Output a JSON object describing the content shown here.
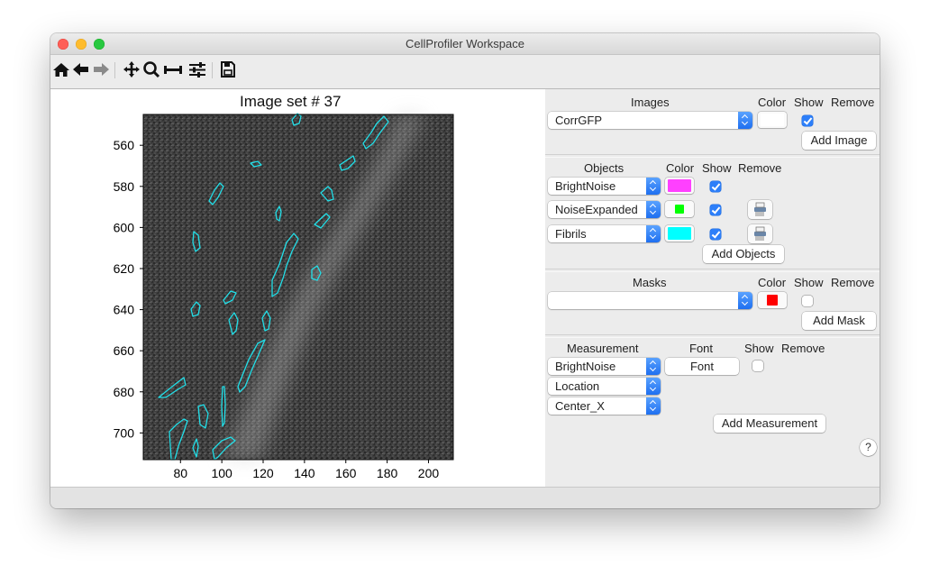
{
  "window": {
    "title": "CellProfiler Workspace"
  },
  "toolbar": {
    "tools": [
      {
        "name": "home-icon"
      },
      {
        "name": "back-arrow-icon"
      },
      {
        "name": "forward-arrow-icon"
      },
      {
        "name": "pan-icon"
      },
      {
        "name": "zoom-icon"
      },
      {
        "name": "subplot-adjust-icon"
      },
      {
        "name": "configure-icon"
      },
      {
        "name": "save-icon"
      }
    ]
  },
  "plot": {
    "title": "Image set # 37",
    "x_ticks": [
      "80",
      "100",
      "120",
      "140",
      "160",
      "180",
      "200"
    ],
    "y_ticks": [
      "560",
      "580",
      "600",
      "620",
      "640",
      "660",
      "680",
      "700"
    ],
    "x_range": [
      62,
      212
    ],
    "y_range": [
      545,
      713
    ],
    "outline_color": "#22dfe8"
  },
  "images": {
    "headers": {
      "name": "Images",
      "color": "Color",
      "show": "Show",
      "remove": "Remove"
    },
    "rows": [
      {
        "value": "CorrGFP",
        "color": "#ffffff",
        "show": true
      }
    ],
    "add_label": "Add Image"
  },
  "objects": {
    "headers": {
      "name": "Objects",
      "color": "Color",
      "show": "Show",
      "remove": "Remove"
    },
    "rows": [
      {
        "value": "BrightNoise",
        "color": "#ff40ff",
        "show": true,
        "removable": false
      },
      {
        "value": "NoiseExpanded",
        "color": "#00ff00",
        "show": true,
        "removable": true
      },
      {
        "value": "Fibrils",
        "color": "#00ffff",
        "show": true,
        "removable": true
      }
    ],
    "add_label": "Add Objects"
  },
  "masks": {
    "headers": {
      "name": "Masks",
      "color": "Color",
      "show": "Show",
      "remove": "Remove"
    },
    "rows": [
      {
        "value": "",
        "color": "#ff0000",
        "show": false
      }
    ],
    "add_label": "Add Mask"
  },
  "measurements": {
    "headers": {
      "name": "Measurement",
      "font": "Font",
      "show": "Show",
      "remove": "Remove"
    },
    "object": "BrightNoise",
    "category": "Location",
    "feature": "Center_X",
    "font_label": "Font",
    "show": false,
    "add_label": "Add Measurement"
  },
  "help": {
    "label": "?"
  }
}
